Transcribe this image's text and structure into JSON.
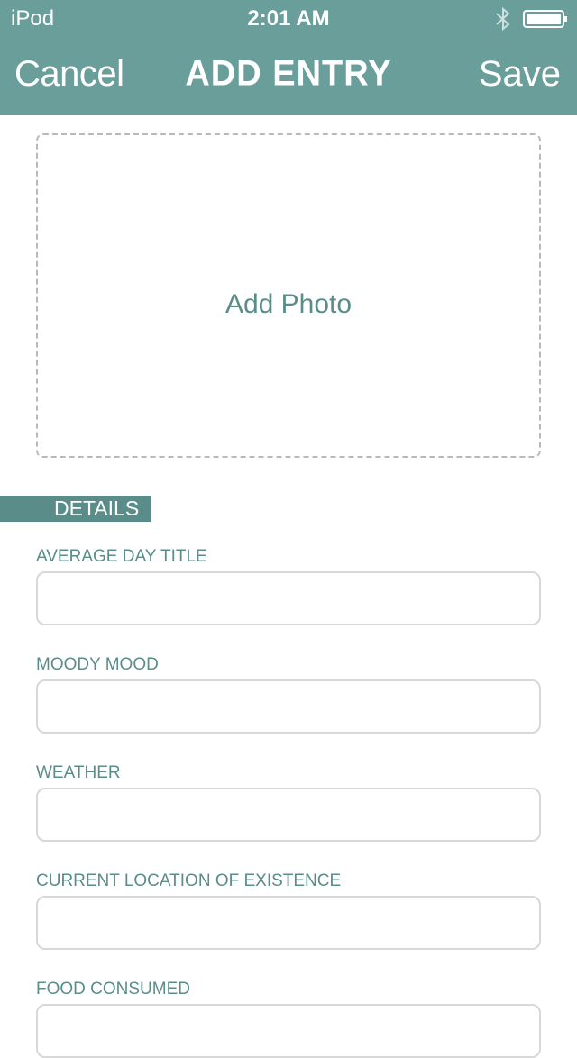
{
  "status_bar": {
    "carrier": "iPod",
    "time": "2:01 AM"
  },
  "nav": {
    "cancel": "Cancel",
    "title": "ADD ENTRY",
    "save": "Save"
  },
  "photo": {
    "label": "Add Photo"
  },
  "section": {
    "label": "DETAILS"
  },
  "fields": [
    {
      "label": "AVERAGE DAY TITLE",
      "value": ""
    },
    {
      "label": "MOODY MOOD",
      "value": ""
    },
    {
      "label": "WEATHER",
      "value": ""
    },
    {
      "label": "CURRENT LOCATION OF EXISTENCE",
      "value": ""
    },
    {
      "label": "FOOD CONSUMED",
      "value": ""
    }
  ],
  "colors": {
    "header": "#6a9e9b",
    "accent": "#5a8d8a",
    "border": "#d8d8d8"
  }
}
